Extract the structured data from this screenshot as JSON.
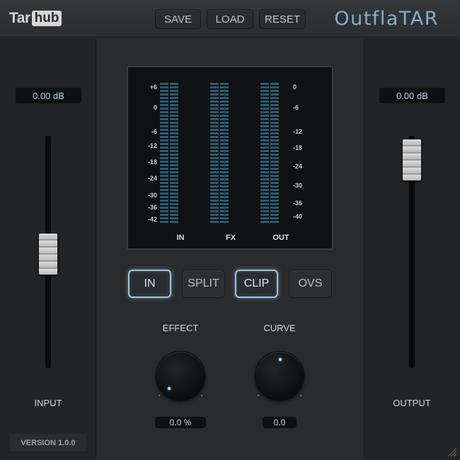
{
  "header": {
    "logo_tar": "Tar",
    "logo_hub": "hub",
    "save_label": "SAVE",
    "load_label": "LOAD",
    "reset_label": "RESET",
    "brand": "OutflaTAR"
  },
  "input": {
    "value": "0.00 dB",
    "label": "INPUT",
    "level": 0.49
  },
  "output": {
    "value": "0.00 dB",
    "label": "OUTPUT",
    "level": 0.95
  },
  "version": "VERSION 1.0.0",
  "meter": {
    "left_scale": [
      "+6",
      "0",
      "-6",
      "-12",
      "-18",
      "-24",
      "-30",
      "-36",
      "-42"
    ],
    "right_scale": [
      "0",
      "-6",
      "-12",
      "-18",
      "-24",
      "-30",
      "-36",
      "-40"
    ],
    "labels": [
      "IN",
      "FX",
      "OUT"
    ]
  },
  "modes": [
    {
      "label": "IN",
      "active": true
    },
    {
      "label": "SPLIT",
      "active": false
    },
    {
      "label": "CLIP",
      "active": true
    },
    {
      "label": "OVS",
      "active": false
    }
  ],
  "knobs": {
    "effect": {
      "label": "EFFECT",
      "value": "0.0 %",
      "position": 0.0
    },
    "curve": {
      "label": "CURVE",
      "value": "0.0",
      "position": 0.5
    }
  },
  "colors": {
    "accent": "#7fb0cc",
    "meter_segment": "#2c5a73",
    "active_glow": "#9fc6dc"
  }
}
